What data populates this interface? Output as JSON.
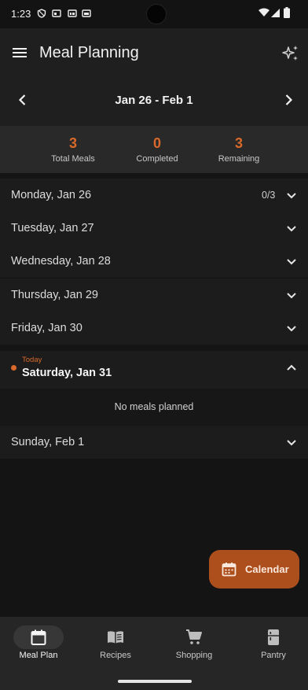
{
  "status_bar": {
    "time": "1:23",
    "icons": [
      "shield-icon",
      "sim-icon",
      "cast-icon",
      "wifi-icon",
      "signal-icon",
      "battery-icon"
    ]
  },
  "app_bar": {
    "title": "Meal Planning",
    "menu_icon": "menu-icon",
    "action_icon": "sparkle-icon"
  },
  "week": {
    "range": "Jan 26 - Feb 1"
  },
  "stats": [
    {
      "value": "3",
      "label": "Total Meals"
    },
    {
      "value": "0",
      "label": "Completed"
    },
    {
      "value": "3",
      "label": "Remaining"
    }
  ],
  "days": [
    {
      "label": "Monday, Jan 26",
      "count": "0/3"
    },
    {
      "label": "Tuesday, Jan 27",
      "count": ""
    },
    {
      "label": "Wednesday, Jan 28",
      "count": ""
    },
    {
      "label": "Thursday, Jan 29",
      "count": ""
    },
    {
      "label": "Friday, Jan 30",
      "count": ""
    }
  ],
  "today": {
    "tag": "Today",
    "label": "Saturday, Jan 31",
    "empty_text": "No meals planned"
  },
  "last_day": {
    "label": "Sunday, Feb 1"
  },
  "fab": {
    "label": "Calendar",
    "icon": "calendar-icon"
  },
  "bottom_nav": [
    {
      "label": "Meal Plan",
      "icon": "calendar-icon",
      "active": true
    },
    {
      "label": "Recipes",
      "icon": "book-icon",
      "active": false
    },
    {
      "label": "Shopping",
      "icon": "cart-icon",
      "active": false
    },
    {
      "label": "Pantry",
      "icon": "fridge-icon",
      "active": false
    }
  ],
  "colors": {
    "accent": "#d8692a",
    "fab": "#ad4f1c",
    "background": "#141414"
  }
}
